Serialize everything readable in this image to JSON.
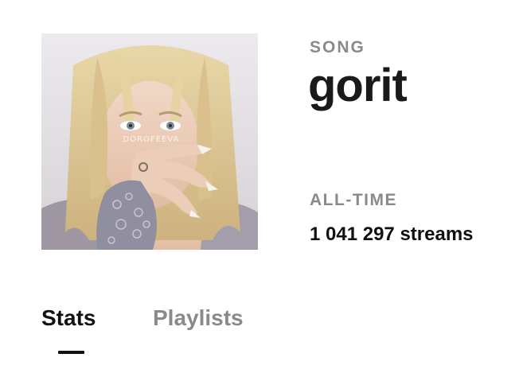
{
  "cover": {
    "artist_watermark": "DOROFEEVA",
    "image_description_icon": "album-cover"
  },
  "song": {
    "type_label": "SONG",
    "title": "gorit"
  },
  "stats": {
    "period_label": "ALL-TIME",
    "streams_text": "1 041 297 streams"
  },
  "tabs": [
    {
      "label": "Stats",
      "active": true
    },
    {
      "label": "Playlists",
      "active": false
    }
  ],
  "colors": {
    "primary_text": "#111111",
    "muted_text": "#8a8a8a",
    "background": "#ffffff"
  }
}
